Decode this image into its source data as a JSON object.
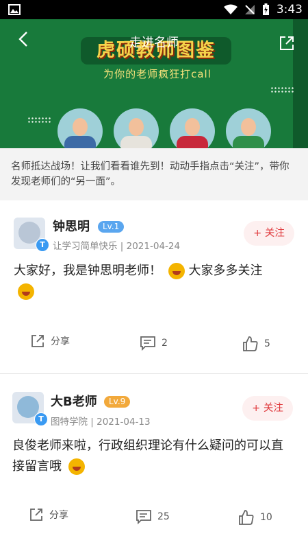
{
  "status_bar": {
    "time": "3:43"
  },
  "header": {
    "title": "走进名师",
    "banner_title": "虎硕教师图鉴",
    "banner_subtitle": "为你的老师疯狂打call"
  },
  "intro": {
    "text": "名师抵达战场！让我们看看谁先到！动动手指点击“关注”，带你发现老师们的“另一面”。"
  },
  "posts": [
    {
      "name": "钟思明",
      "level": "Lv.1",
      "level_color": "#5aa6ef",
      "meta": "让学习简单快乐 | 2021-04-24",
      "follow_label": "+ 关注",
      "content_1": "大家好，我是钟思明老师！",
      "content_2": "大家多多关注",
      "share_label": "分享",
      "comment_count": "2",
      "like_count": "5"
    },
    {
      "name": "大B老师",
      "level": "Lv.9",
      "level_color": "#f2a93b",
      "meta": "图特学院 | 2021-04-13",
      "follow_label": "+ 关注",
      "content_1": "良俊老师来啦，行政组织理论有什么疑问的可以直接留言哦",
      "share_label": "分享",
      "comment_count": "25",
      "like_count": "10"
    }
  ]
}
